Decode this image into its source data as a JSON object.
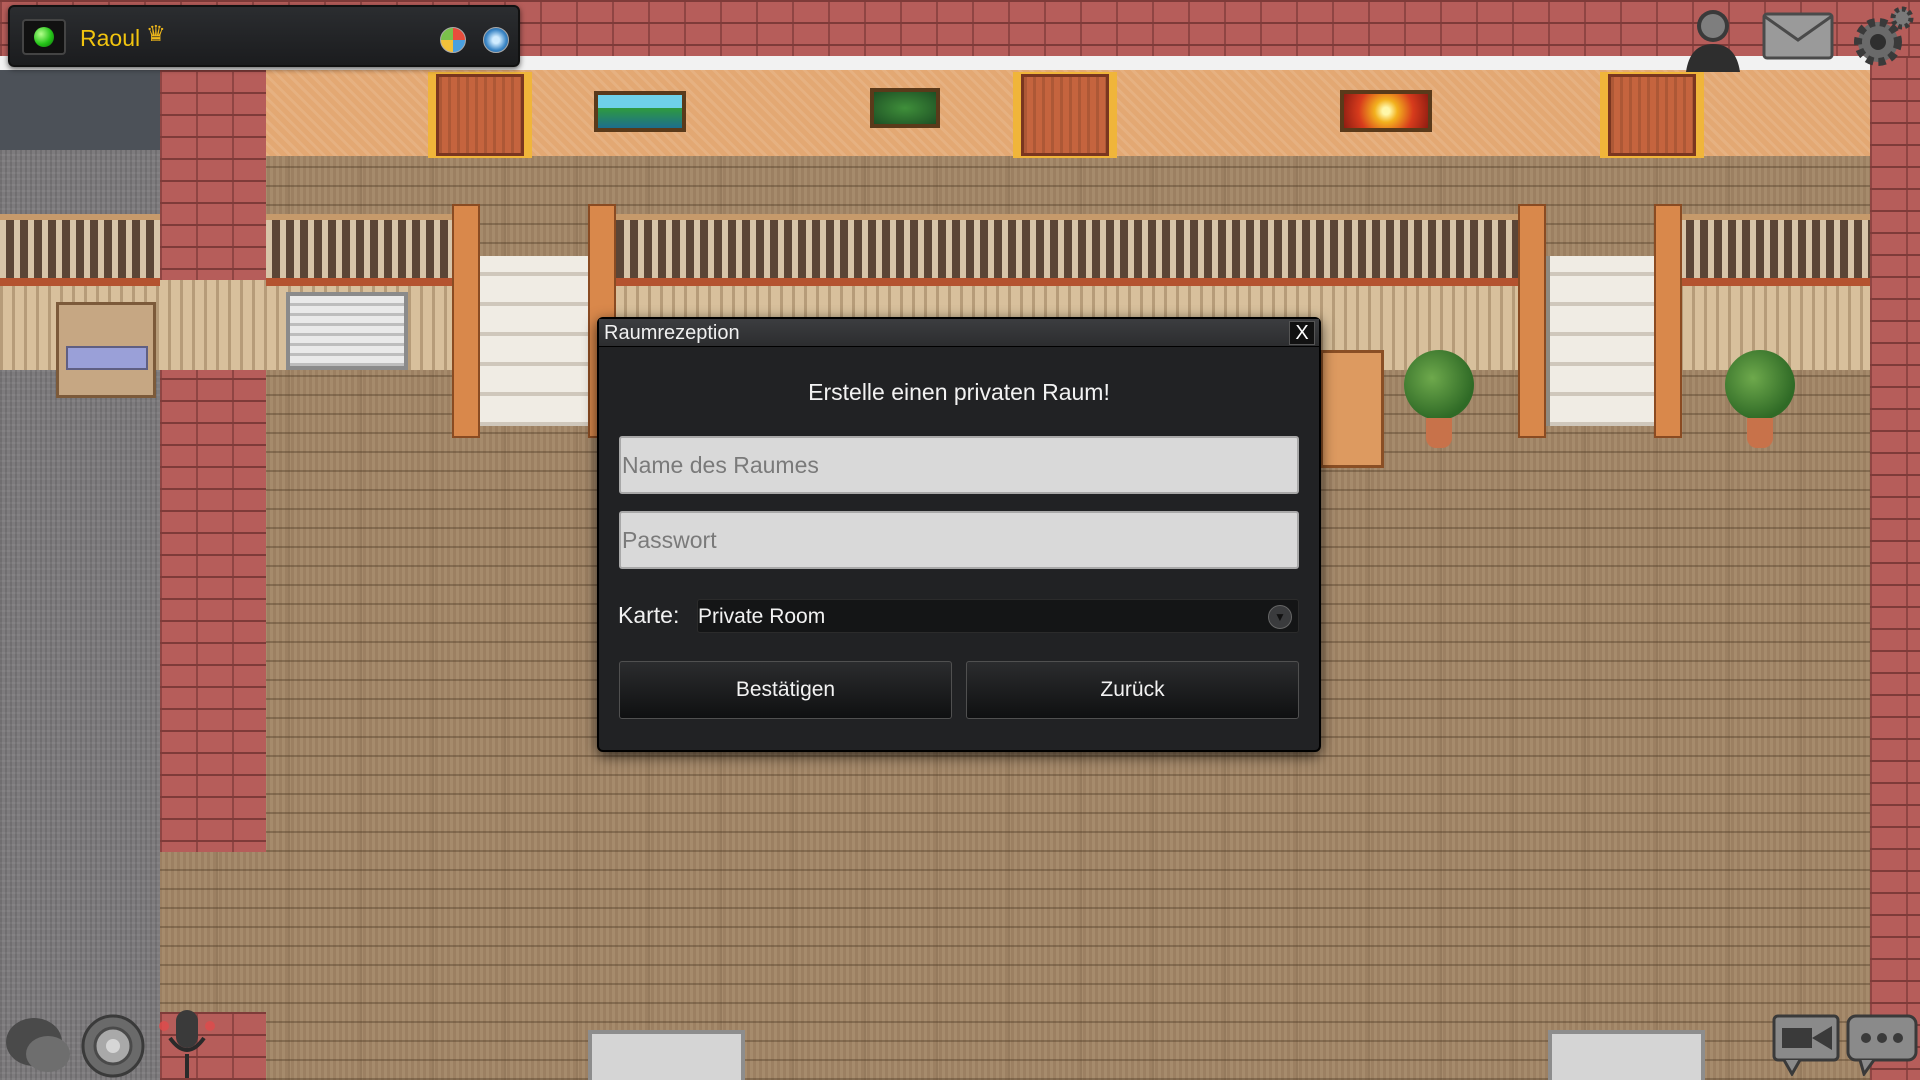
{
  "hud": {
    "username": "Raoul",
    "crown_glyph": "♛",
    "status_color": "#25c419",
    "icons": [
      "status-indicator-icon",
      "crown-icon",
      "color-wheel-icon",
      "globe-icon",
      "avatar-icon",
      "mail-icon",
      "settings-gear-icon",
      "chat-bubbles-icon",
      "speaker-icon",
      "microphone-icon",
      "camera-icon",
      "chat-ellipsis-icon"
    ]
  },
  "dialog": {
    "title": "Raumrezeption",
    "close_label": "X",
    "heading": "Erstelle einen privaten Raum!",
    "name_placeholder": "Name des Raumes",
    "password_placeholder": "Passwort",
    "map_label": "Karte:",
    "map_selected": "Private Room",
    "confirm_label": "Bestätigen",
    "back_label": "Zurück"
  },
  "colors": {
    "accent_username": "#f1c40f",
    "dialog_bg": "#212224",
    "input_bg": "#d9d9d9"
  }
}
